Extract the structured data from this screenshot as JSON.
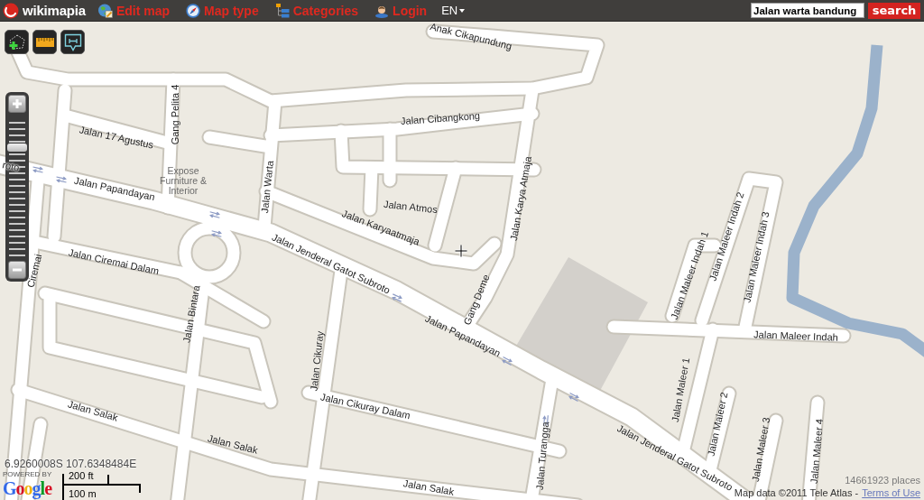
{
  "header": {
    "logo": "wikimapia",
    "menu": [
      {
        "kind": "edit",
        "label": "Edit map"
      },
      {
        "kind": "compass",
        "label": "Map type"
      },
      {
        "kind": "categories",
        "label": "Categories"
      },
      {
        "kind": "login",
        "label": "Login"
      }
    ],
    "language": "EN",
    "search": {
      "value": "Jalan warta bandung",
      "button": "search"
    }
  },
  "tools": [
    {
      "kind": "polygon"
    },
    {
      "kind": "ruler"
    },
    {
      "kind": "comment"
    }
  ],
  "zoom": {
    "level": 0.8
  },
  "map": {
    "streets": [
      "Anak Cikapundung",
      "Jalan Cibangkong",
      "Gang Pelita 4",
      "Jalan 17 Agustus",
      "roto",
      "Jalan Papandayan",
      "Jalan Warta",
      "Jalan Atmos",
      "Jalan Karyaatmaja",
      "Jalan Karya Atmaja",
      "Jalan Jenderal Gatot Subroto",
      "Jalan Ciremai Dalam",
      "Ciremai",
      "Jalan Bintara",
      "Gang Deme",
      "Jalan Papandayan",
      "Jalan Cikuray",
      "Jalan Cikuray Dalam",
      "Jalan Salak",
      "Jalan Salak",
      "Jalan Salak",
      "Jalan Turangga",
      "Jalan Jenderal Gatot Subroto",
      "Jalan Maleer Indah 1",
      "Jalan Maleer Indah 2",
      "Jalan Maleer Indah 3",
      "Jalan Maleer Indah",
      "Jalan Maleer 1",
      "Jalan Maleer 2",
      "Jalan Maleer 3",
      "Jalan Maleer 4"
    ],
    "places": [
      "Expose Furniture & Interior"
    ]
  },
  "footer": {
    "coordinates": "6.9260008S 107.6348484E",
    "powered_by": "POWERED BY",
    "logo": "Google",
    "scale": {
      "imperial": "200 ft",
      "metric": "100 m"
    },
    "places_count": "14661923 places",
    "copyright": "Map data ©2011 Tele Atlas -",
    "terms_link": "Terms of Use"
  }
}
